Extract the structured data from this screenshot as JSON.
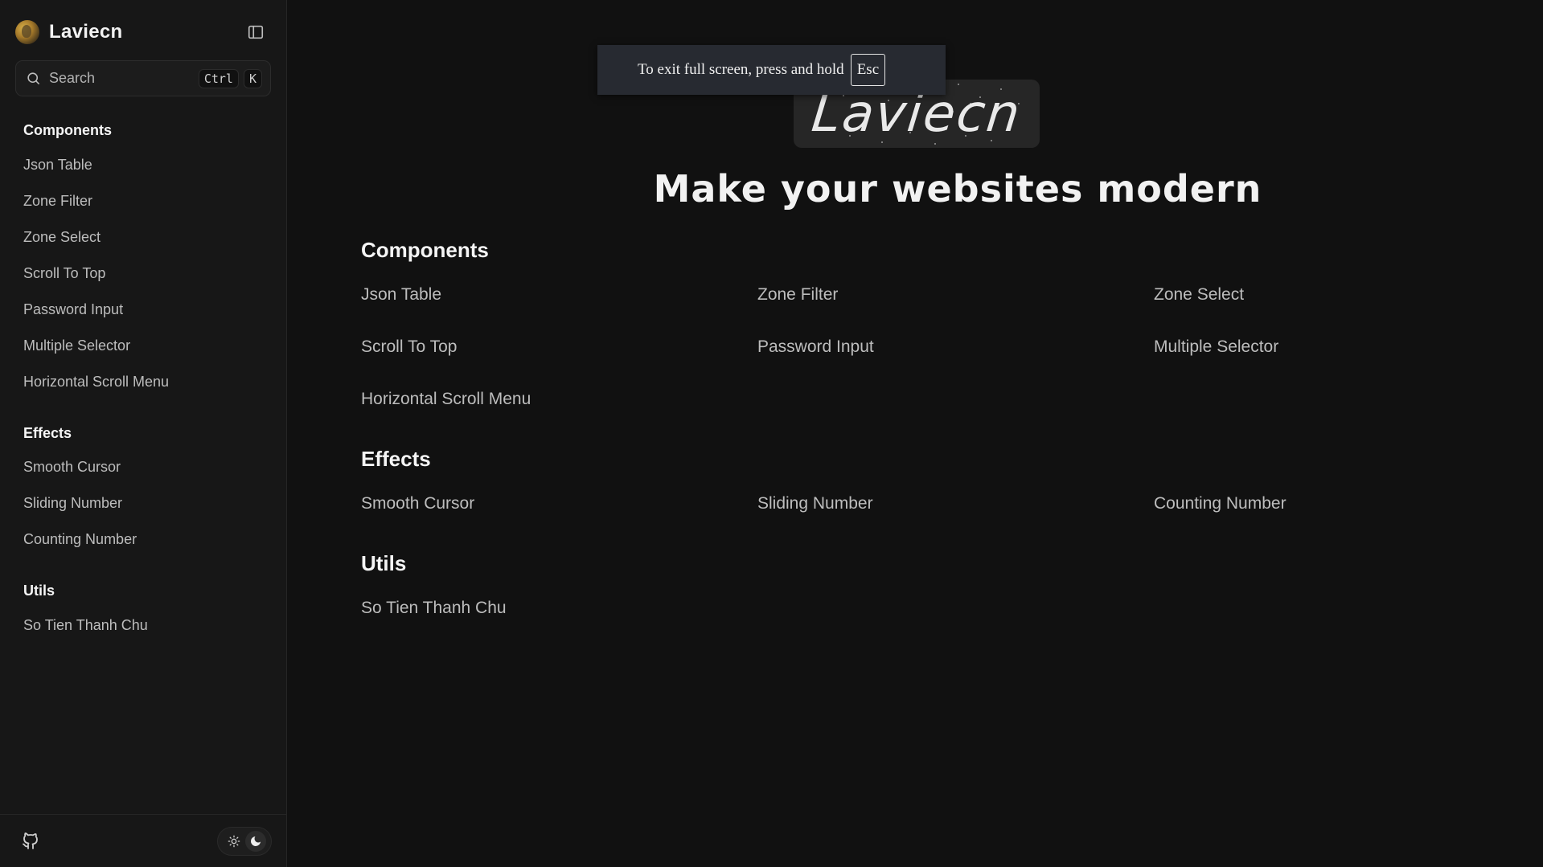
{
  "brand": {
    "name": "Laviecn"
  },
  "search": {
    "placeholder": "Search",
    "shortcut_ctrl": "Ctrl",
    "shortcut_key": "K"
  },
  "sidebar": {
    "groups": [
      {
        "title": "Components",
        "items": [
          "Json Table",
          "Zone Filter",
          "Zone Select",
          "Scroll To Top",
          "Password Input",
          "Multiple Selector",
          "Horizontal Scroll Menu"
        ]
      },
      {
        "title": "Effects",
        "items": [
          "Smooth Cursor",
          "Sliding Number",
          "Counting Number"
        ]
      },
      {
        "title": "Utils",
        "items": [
          "So Tien Thanh Chu"
        ]
      }
    ]
  },
  "hero": {
    "logo_text": "Laviecn",
    "title": "Make your websites modern"
  },
  "main": {
    "sections": [
      {
        "title": "Components",
        "items": [
          "Json Table",
          "Zone Filter",
          "Zone Select",
          "Scroll To Top",
          "Password Input",
          "Multiple Selector",
          "Horizontal Scroll Menu"
        ]
      },
      {
        "title": "Effects",
        "items": [
          "Smooth Cursor",
          "Sliding Number",
          "Counting Number"
        ]
      },
      {
        "title": "Utils",
        "items": [
          "So Tien Thanh Chu"
        ]
      }
    ]
  },
  "toast": {
    "message": "To exit full screen, press and hold",
    "key": "Esc"
  },
  "icons": {
    "toggle": "sidebar-toggle-icon",
    "search": "search-icon",
    "github": "github-icon",
    "light": "sun-icon",
    "dark": "moon-icon"
  },
  "colors": {
    "background": "#111111",
    "sidebar": "#171717",
    "text": "#e6e6e6",
    "muted": "#bdbdbd"
  }
}
